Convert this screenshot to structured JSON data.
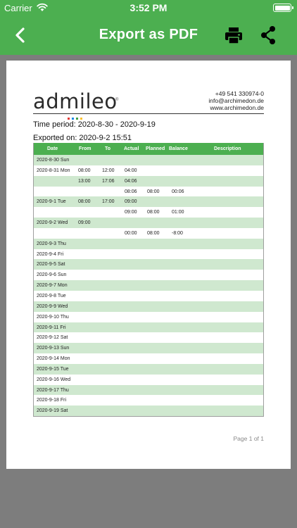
{
  "status": {
    "carrier": "Carrier",
    "time": "3:52 PM"
  },
  "nav": {
    "title": "Export as PDF"
  },
  "document": {
    "logo_text": "admileo",
    "logo_reg": "®",
    "contact": [
      "+49 541 330974-0",
      "info@archimedon.de",
      "www.archimedon.de"
    ],
    "period": "Time period: 2020-8-30  -  2020-9-19",
    "exported": "Exported on: 2020-9-2 15:51",
    "columns": [
      "Date",
      "From",
      "To",
      "Actual",
      "Planned",
      "Balance",
      "Description"
    ],
    "rows": [
      [
        "2020-8-30 Sun",
        "",
        "",
        "",
        "",
        "",
        ""
      ],
      [
        "2020-8-31 Mon",
        "08:00",
        "12:00",
        "04:00",
        "",
        "",
        ""
      ],
      [
        "",
        "13:00",
        "17:06",
        "04:06",
        "",
        "",
        ""
      ],
      [
        "",
        "",
        "",
        "08:06",
        "08:00",
        "00:06",
        ""
      ],
      [
        "2020-9-1 Tue",
        "08:00",
        "17:00",
        "09:00",
        "",
        "",
        ""
      ],
      [
        "",
        "",
        "",
        "09:00",
        "08:00",
        "01:00",
        ""
      ],
      [
        "2020-9-2 Wed",
        "09:00",
        "",
        "",
        "",
        "",
        ""
      ],
      [
        "",
        "",
        "",
        "00:00",
        "08:00",
        "-8:00",
        ""
      ],
      [
        "2020-9-3 Thu",
        "",
        "",
        "",
        "",
        "",
        ""
      ],
      [
        "2020-9-4 Fri",
        "",
        "",
        "",
        "",
        "",
        ""
      ],
      [
        "2020-9-5 Sat",
        "",
        "",
        "",
        "",
        "",
        ""
      ],
      [
        "2020-9-6 Sun",
        "",
        "",
        "",
        "",
        "",
        ""
      ],
      [
        "2020-9-7 Mon",
        "",
        "",
        "",
        "",
        "",
        ""
      ],
      [
        "2020-9-8 Tue",
        "",
        "",
        "",
        "",
        "",
        ""
      ],
      [
        "2020-9-9 Wed",
        "",
        "",
        "",
        "",
        "",
        ""
      ],
      [
        "2020-9-10 Thu",
        "",
        "",
        "",
        "",
        "",
        ""
      ],
      [
        "2020-9-11 Fri",
        "",
        "",
        "",
        "",
        "",
        ""
      ],
      [
        "2020-9-12 Sat",
        "",
        "",
        "",
        "",
        "",
        ""
      ],
      [
        "2020-9-13 Sun",
        "",
        "",
        "",
        "",
        "",
        ""
      ],
      [
        "2020-9-14 Mon",
        "",
        "",
        "",
        "",
        "",
        ""
      ],
      [
        "2020-9-15 Tue",
        "",
        "",
        "",
        "",
        "",
        ""
      ],
      [
        "2020-9-16 Wed",
        "",
        "",
        "",
        "",
        "",
        ""
      ],
      [
        "2020-9-17 Thu",
        "",
        "",
        "",
        "",
        "",
        ""
      ],
      [
        "2020-9-18 Fri",
        "",
        "",
        "",
        "",
        "",
        ""
      ],
      [
        "2020-9-19 Sat",
        "",
        "",
        "",
        "",
        "",
        ""
      ]
    ],
    "page_label": "Page 1 of 1"
  },
  "icons": {
    "back": "chevron-left-icon",
    "print": "printer-icon",
    "share": "share-icon",
    "wifi": "wifi-icon",
    "battery": "battery-icon"
  },
  "colors": {
    "accent": "#4caf50",
    "row_alt": "#cfe8cf",
    "backdrop": "#7d7d7d"
  }
}
